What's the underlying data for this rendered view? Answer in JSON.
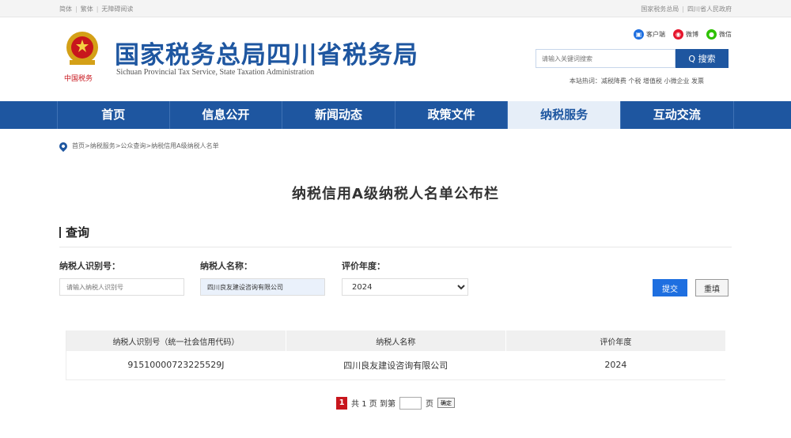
{
  "topbar": {
    "lang_simplified": "简体",
    "lang_traditional": "繁体",
    "accessibility": "无障碍阅读",
    "link_state_tax": "国家税务总局",
    "link_sichuan_gov": "四川省人民政府"
  },
  "header": {
    "title": "国家税务总局四川省税务局",
    "subtitle": "Sichuan Provincial Tax Service, State Taxation Administration",
    "social": [
      "客户端",
      "微博",
      "微信"
    ],
    "search_placeholder": "请输入关键词搜索",
    "search_button": "Q 搜索",
    "hot_words": "本站热词：减税降费 个税 增值税 小微企业 发票",
    "colors": {
      "brand": "#1e56a0",
      "weibo": "#e6162d",
      "wechat": "#2dc100",
      "client": "#1e6fe0"
    }
  },
  "nav": {
    "items": [
      "首页",
      "信息公开",
      "新闻动态",
      "政策文件",
      "纳税服务",
      "互动交流"
    ],
    "active": "纳税服务"
  },
  "breadcrumb": "首页>纳税服务>公众查询>纳税信用A级纳税人名单",
  "page_title": "纳税信用A级纳税人名单公布栏",
  "query": {
    "section_title": "查询",
    "id_label": "纳税人识别号：",
    "id_placeholder": "请输入纳税人识别号",
    "name_label": "纳税人名称：",
    "name_value": "四川良友建设咨询有限公司",
    "year_label": "评价年度：",
    "year_value": "2024",
    "submit": "提交",
    "reset": "重填"
  },
  "table": {
    "headers": [
      "纳税人识别号（统一社会信用代码）",
      "纳税人名称",
      "评价年度"
    ],
    "rows": [
      [
        "91510000723225529J",
        "四川良友建设咨询有限公司",
        "2024"
      ]
    ]
  },
  "pager": {
    "current": "1",
    "total_text": "共 1 页 到第",
    "page_suffix": "页",
    "confirm": "确定"
  }
}
